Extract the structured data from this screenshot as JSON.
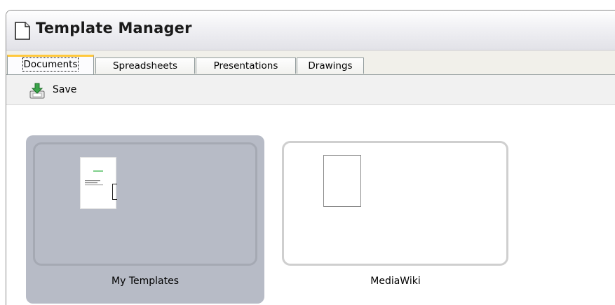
{
  "window": {
    "title": "Template Manager",
    "title_icon": "document-icon"
  },
  "tabs": [
    {
      "label": "Documents",
      "active": true
    },
    {
      "label": "Spreadsheets",
      "active": false
    },
    {
      "label": "Presentations",
      "active": false
    },
    {
      "label": "Drawings",
      "active": false
    }
  ],
  "toolbar": {
    "save_label": "Save",
    "save_icon": "save-download-icon"
  },
  "folders": [
    {
      "name": "My Templates",
      "selected": true,
      "thumbnail": "document-thumbnail"
    },
    {
      "name": "MediaWiki",
      "selected": false,
      "thumbnail": "empty-page-thumbnail"
    }
  ],
  "colors": {
    "active_tab_accent": "#ffc83c",
    "selected_folder_bg": "#b7bbc6",
    "save_icon_green": "#3aa44a"
  }
}
